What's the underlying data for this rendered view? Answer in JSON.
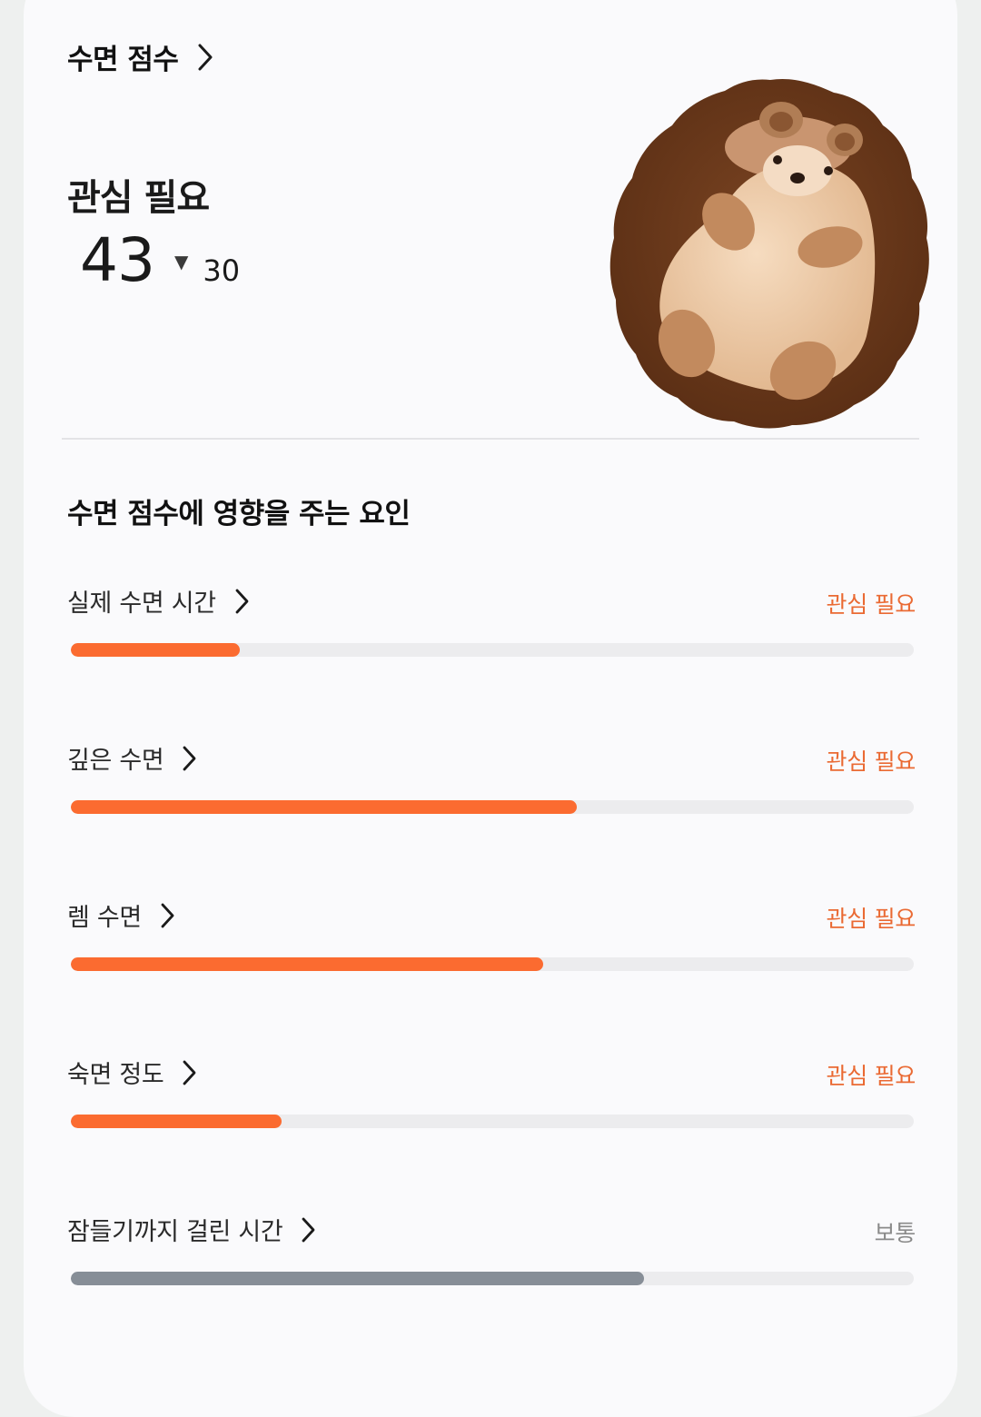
{
  "header": {
    "title": "수면 점수"
  },
  "summary": {
    "status": "관심 필요",
    "score": "43",
    "change_icon": "triangle-down-icon",
    "change_value": "30"
  },
  "mascot": {
    "description_icon": "hedgehog-mascot"
  },
  "factors_section": {
    "title": "수면 점수에 영향을 주는 요인",
    "items": [
      {
        "label": "실제 수면 시간",
        "status": "관심 필요",
        "level": 0.2,
        "color": "#fb6b30"
      },
      {
        "label": "깊은 수면",
        "status": "관심 필요",
        "level": 0.6,
        "color": "#fb6b30"
      },
      {
        "label": "렘 수면",
        "status": "관심 필요",
        "level": 0.56,
        "color": "#fb6b30"
      },
      {
        "label": "숙면 정도",
        "status": "관심 필요",
        "level": 0.25,
        "color": "#fb6b30"
      },
      {
        "label": "잠들기까지 걸린 시간",
        "status": "보통",
        "level": 0.68,
        "color": "#878e97"
      }
    ]
  },
  "colors": {
    "attention": "#ea6a33",
    "bar_attention": "#fb6b30",
    "bar_normal": "#878e97",
    "track": "#ececee"
  }
}
